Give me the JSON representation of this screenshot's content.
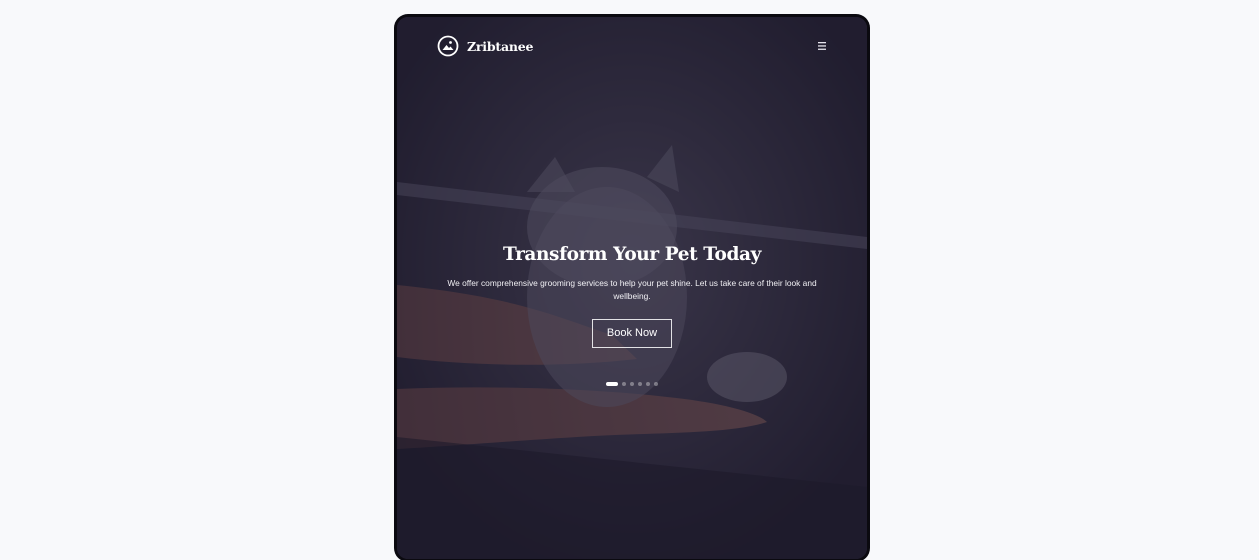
{
  "brand": {
    "name": "Zribtanee",
    "logo_icon": "mountain-sun-circle-icon"
  },
  "nav": {
    "menu_icon": "hamburger-menu-icon"
  },
  "hero": {
    "title": "Transform Your Pet Today",
    "description": "We offer comprehensive grooming services to help your pet shine. Let us take care of their look and wellbeing.",
    "cta_label": "Book Now",
    "background_image": "cat-being-bathed-photo"
  },
  "slider": {
    "total_slides": 6,
    "active_slide": 1
  },
  "colors": {
    "overlay": "#1c182c",
    "page_background": "#f8f9fb",
    "frame": "#0b0a10",
    "text": "#ffffff"
  }
}
